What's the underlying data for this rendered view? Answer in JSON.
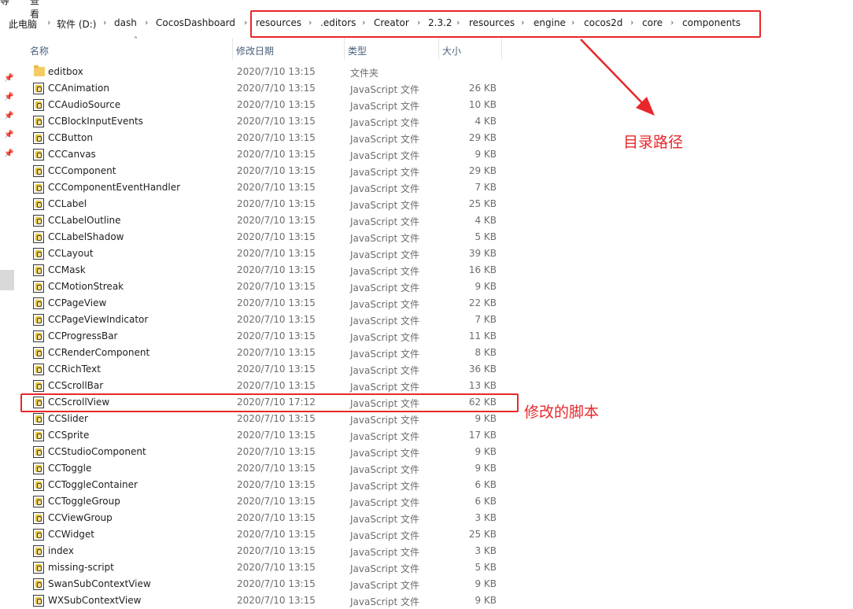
{
  "top_clipped": {
    "left": "等",
    "right": "查看"
  },
  "breadcrumb": [
    "此电脑",
    "软件 (D:)",
    "dash",
    "CocosDashboard",
    "resources",
    ".editors",
    "Creator",
    "2.3.2",
    "resources",
    "engine",
    "cocos2d",
    "core",
    "components"
  ],
  "columns": {
    "name": "名称",
    "date": "修改日期",
    "type": "类型",
    "size": "大小"
  },
  "sidebar": {
    "pin_icon": "pin-icon"
  },
  "files": [
    {
      "name": "editbox",
      "date": "2020/7/10 13:15",
      "type": "文件夹",
      "size": "",
      "icon": "folder-icon"
    },
    {
      "name": "CCAnimation",
      "date": "2020/7/10 13:15",
      "type": "JavaScript 文件",
      "size": "26 KB",
      "icon": "js-file-icon"
    },
    {
      "name": "CCAudioSource",
      "date": "2020/7/10 13:15",
      "type": "JavaScript 文件",
      "size": "10 KB",
      "icon": "js-file-icon"
    },
    {
      "name": "CCBlockInputEvents",
      "date": "2020/7/10 13:15",
      "type": "JavaScript 文件",
      "size": "4 KB",
      "icon": "js-file-icon"
    },
    {
      "name": "CCButton",
      "date": "2020/7/10 13:15",
      "type": "JavaScript 文件",
      "size": "29 KB",
      "icon": "js-file-icon"
    },
    {
      "name": "CCCanvas",
      "date": "2020/7/10 13:15",
      "type": "JavaScript 文件",
      "size": "9 KB",
      "icon": "js-file-icon"
    },
    {
      "name": "CCComponent",
      "date": "2020/7/10 13:15",
      "type": "JavaScript 文件",
      "size": "29 KB",
      "icon": "js-file-icon"
    },
    {
      "name": "CCComponentEventHandler",
      "date": "2020/7/10 13:15",
      "type": "JavaScript 文件",
      "size": "7 KB",
      "icon": "js-file-icon"
    },
    {
      "name": "CCLabel",
      "date": "2020/7/10 13:15",
      "type": "JavaScript 文件",
      "size": "25 KB",
      "icon": "js-file-icon"
    },
    {
      "name": "CCLabelOutline",
      "date": "2020/7/10 13:15",
      "type": "JavaScript 文件",
      "size": "4 KB",
      "icon": "js-file-icon"
    },
    {
      "name": "CCLabelShadow",
      "date": "2020/7/10 13:15",
      "type": "JavaScript 文件",
      "size": "5 KB",
      "icon": "js-file-icon"
    },
    {
      "name": "CCLayout",
      "date": "2020/7/10 13:15",
      "type": "JavaScript 文件",
      "size": "39 KB",
      "icon": "js-file-icon"
    },
    {
      "name": "CCMask",
      "date": "2020/7/10 13:15",
      "type": "JavaScript 文件",
      "size": "16 KB",
      "icon": "js-file-icon"
    },
    {
      "name": "CCMotionStreak",
      "date": "2020/7/10 13:15",
      "type": "JavaScript 文件",
      "size": "9 KB",
      "icon": "js-file-icon"
    },
    {
      "name": "CCPageView",
      "date": "2020/7/10 13:15",
      "type": "JavaScript 文件",
      "size": "22 KB",
      "icon": "js-file-icon"
    },
    {
      "name": "CCPageViewIndicator",
      "date": "2020/7/10 13:15",
      "type": "JavaScript 文件",
      "size": "7 KB",
      "icon": "js-file-icon"
    },
    {
      "name": "CCProgressBar",
      "date": "2020/7/10 13:15",
      "type": "JavaScript 文件",
      "size": "11 KB",
      "icon": "js-file-icon"
    },
    {
      "name": "CCRenderComponent",
      "date": "2020/7/10 13:15",
      "type": "JavaScript 文件",
      "size": "8 KB",
      "icon": "js-file-icon"
    },
    {
      "name": "CCRichText",
      "date": "2020/7/10 13:15",
      "type": "JavaScript 文件",
      "size": "36 KB",
      "icon": "js-file-icon"
    },
    {
      "name": "CCScrollBar",
      "date": "2020/7/10 13:15",
      "type": "JavaScript 文件",
      "size": "13 KB",
      "icon": "js-file-icon"
    },
    {
      "name": "CCScrollView",
      "date": "2020/7/10 17:12",
      "type": "JavaScript 文件",
      "size": "62 KB",
      "icon": "js-file-icon"
    },
    {
      "name": "CCSlider",
      "date": "2020/7/10 13:15",
      "type": "JavaScript 文件",
      "size": "9 KB",
      "icon": "js-file-icon"
    },
    {
      "name": "CCSprite",
      "date": "2020/7/10 13:15",
      "type": "JavaScript 文件",
      "size": "17 KB",
      "icon": "js-file-icon"
    },
    {
      "name": "CCStudioComponent",
      "date": "2020/7/10 13:15",
      "type": "JavaScript 文件",
      "size": "9 KB",
      "icon": "js-file-icon"
    },
    {
      "name": "CCToggle",
      "date": "2020/7/10 13:15",
      "type": "JavaScript 文件",
      "size": "9 KB",
      "icon": "js-file-icon"
    },
    {
      "name": "CCToggleContainer",
      "date": "2020/7/10 13:15",
      "type": "JavaScript 文件",
      "size": "6 KB",
      "icon": "js-file-icon"
    },
    {
      "name": "CCToggleGroup",
      "date": "2020/7/10 13:15",
      "type": "JavaScript 文件",
      "size": "6 KB",
      "icon": "js-file-icon"
    },
    {
      "name": "CCViewGroup",
      "date": "2020/7/10 13:15",
      "type": "JavaScript 文件",
      "size": "3 KB",
      "icon": "js-file-icon"
    },
    {
      "name": "CCWidget",
      "date": "2020/7/10 13:15",
      "type": "JavaScript 文件",
      "size": "25 KB",
      "icon": "js-file-icon"
    },
    {
      "name": "index",
      "date": "2020/7/10 13:15",
      "type": "JavaScript 文件",
      "size": "3 KB",
      "icon": "js-file-icon"
    },
    {
      "name": "missing-script",
      "date": "2020/7/10 13:15",
      "type": "JavaScript 文件",
      "size": "5 KB",
      "icon": "js-file-icon"
    },
    {
      "name": "SwanSubContextView",
      "date": "2020/7/10 13:15",
      "type": "JavaScript 文件",
      "size": "9 KB",
      "icon": "js-file-icon"
    },
    {
      "name": "WXSubContextView",
      "date": "2020/7/10 13:15",
      "type": "JavaScript 文件",
      "size": "9 KB",
      "icon": "js-file-icon"
    }
  ],
  "annotations": {
    "path_label": "目录路径",
    "modified_label": "修改的脚本",
    "color": "#e8272a"
  }
}
